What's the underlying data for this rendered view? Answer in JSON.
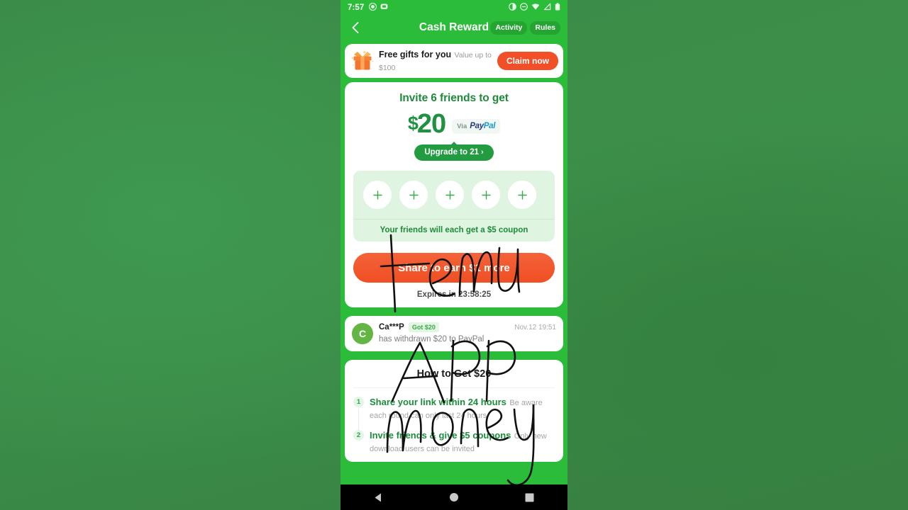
{
  "statusbar": {
    "time": "7:57",
    "left_icons": [
      "record-icon",
      "screenshot-icon"
    ],
    "right_icons": [
      "brightness-icon",
      "dnd-icon",
      "wifi-icon",
      "signal-icon",
      "battery-icon"
    ]
  },
  "appbar": {
    "back_icon": "back-chevron-icon",
    "title": "Cash Reward",
    "tabs": [
      {
        "label": "Activity"
      },
      {
        "label": "Rules"
      }
    ]
  },
  "gift_banner": {
    "icon": "gift-box-icon",
    "title": "Free gifts for you",
    "subtitle": "Value up to $100",
    "button_label": "Claim now"
  },
  "main_card": {
    "headline": "Invite 6 friends to get",
    "amount_currency": "$",
    "amount_value": "20",
    "paypal_via": "Via",
    "paypal_logo_part1": "Pay",
    "paypal_logo_part2": "Pal",
    "upgrade_label": "Upgrade to 21",
    "upgrade_chevron": "›",
    "slots": [
      {
        "icon": "plus-icon"
      },
      {
        "icon": "plus-icon"
      },
      {
        "icon": "plus-icon"
      },
      {
        "icon": "plus-icon"
      },
      {
        "icon": "plus-icon"
      }
    ],
    "coupon_note": "Your friends will each get a $5 coupon",
    "share_label": "Share to earn $1 more",
    "expires_label": "Expires in 23:58:25"
  },
  "testimonial": {
    "avatar_initial": "C",
    "name": "Ca***P",
    "badge": "Got $20",
    "date": "Nov.12 19:51",
    "message": "has withdrawn $20 to PayPal"
  },
  "how_to_get": {
    "title": "How to Get $20",
    "steps": [
      {
        "num": "1",
        "head": "Share your link within 24 hours",
        "sub": "Be aware each round can only last 24 hours"
      },
      {
        "num": "2",
        "head": "Invite friends & give $5 coupons",
        "sub": "Only new download users can be invited"
      }
    ]
  },
  "navbar": {
    "back_icon": "triangle-back-icon",
    "home_icon": "circle-home-icon",
    "recents_icon": "square-recents-icon"
  },
  "annotation": {
    "overlay_text": "temu app money",
    "ink_color": "#111111"
  },
  "colors": {
    "brand_green": "#2bbd3a",
    "dark_green_text": "#1f8a3b",
    "accent_orange": "#f04f28",
    "panel_green": "#dff5e1",
    "page_background": "#3b8b48"
  }
}
